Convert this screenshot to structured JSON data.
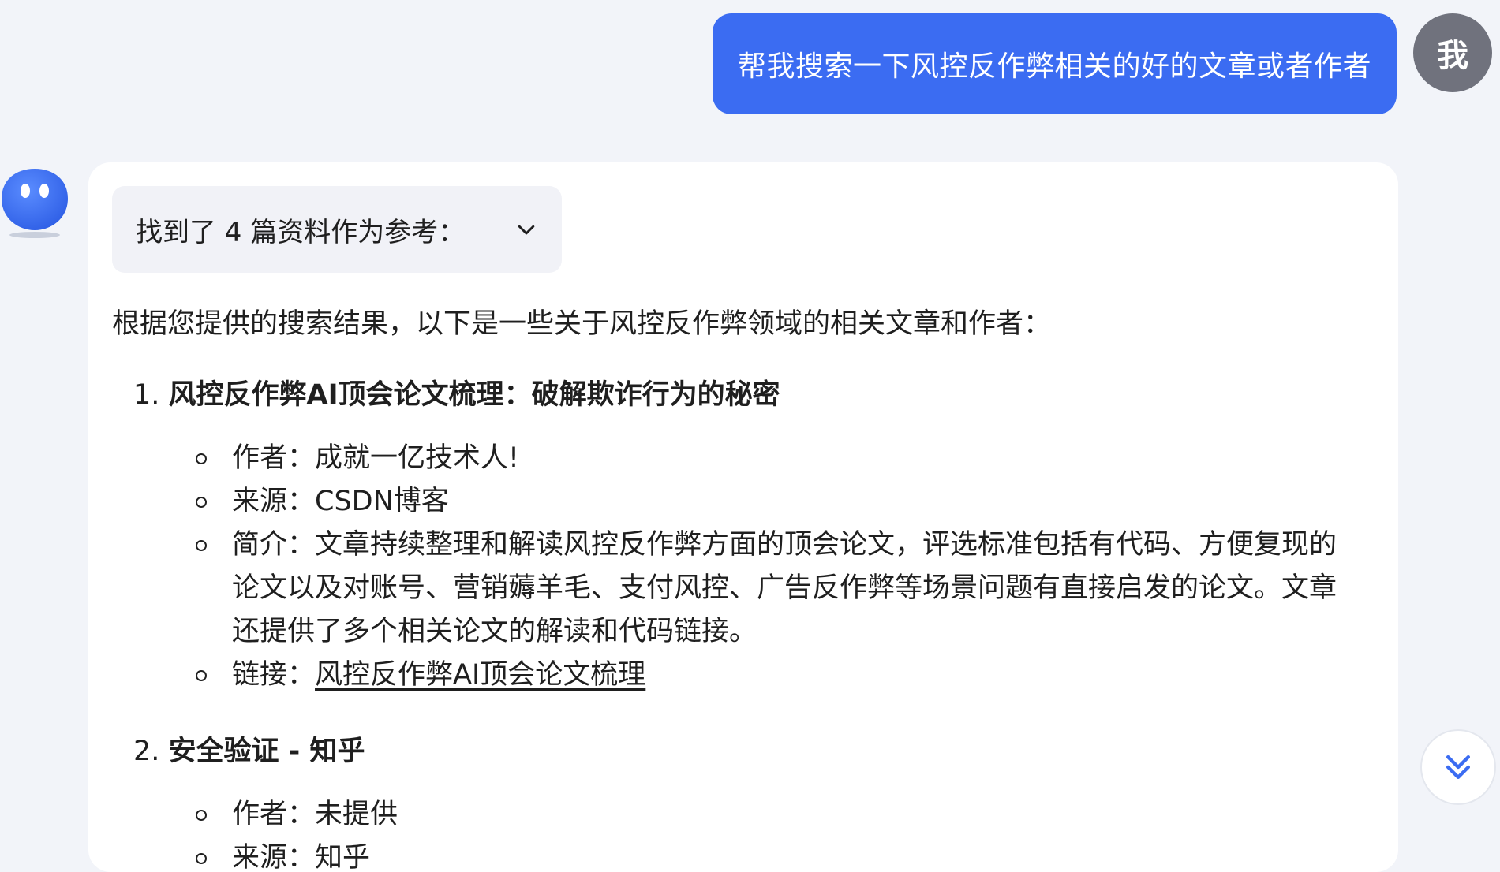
{
  "user_message": {
    "text": "帮我搜索一下风控反作弊相关的好的文章或者作者",
    "avatar_label": "我",
    "bubble_color": "#3b6cf2"
  },
  "assistant": {
    "references_summary": "找到了 4 篇资料作为参考：",
    "intro": "根据您提供的搜索结果，以下是一些关于风控反作弊领域的相关文章和作者：",
    "items": [
      {
        "number": "1.",
        "title": "风控反作弊AI顶会论文梳理：破解欺诈行为的秘密",
        "author": "作者：成就一亿技术人!",
        "source": "来源：CSDN博客",
        "summary": "简介：文章持续整理和解读风控反作弊方面的顶会论文，评选标准包括有代码、方便复现的论文以及对账号、营销薅羊毛、支付风控、广告反作弊等场景问题有直接启发的论文。文章还提供了多个相关论文的解读和代码链接。",
        "link_label": "链接：",
        "link_text": "风控反作弊AI顶会论文梳理"
      },
      {
        "number": "2.",
        "title": "安全验证 - 知乎",
        "author": "作者：未提供",
        "source": "来源：知乎"
      }
    ]
  },
  "icons": {
    "bot_avatar": "robot-face-icon",
    "refs_toggle": "chevron-down-icon",
    "scroll_down": "double-chevron-down-icon"
  },
  "colors": {
    "background": "#f2f4f9",
    "accent": "#3b6cf2",
    "user_avatar": "#70727d"
  }
}
